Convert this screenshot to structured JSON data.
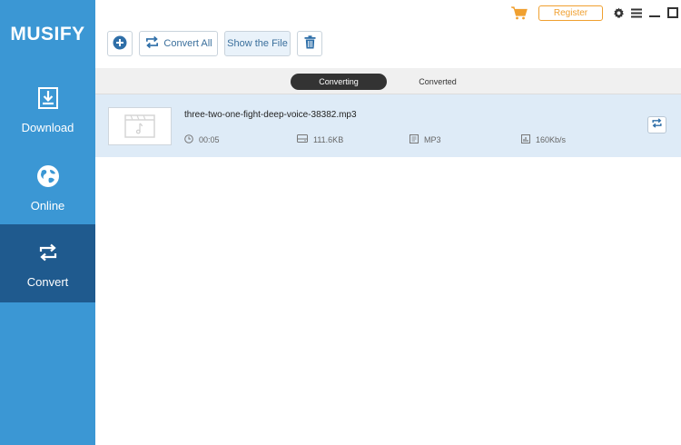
{
  "app": {
    "title": "MUSIFY"
  },
  "sidebar": {
    "items": [
      {
        "label": "Download",
        "icon": "download-icon"
      },
      {
        "label": "Online",
        "icon": "globe-icon"
      },
      {
        "label": "Convert",
        "icon": "convert-icon",
        "active": true
      }
    ]
  },
  "toolbar": {
    "add_icon": "plus-circle-icon",
    "convert_all_label": "Convert All",
    "show_file_label": "Show the File",
    "delete_icon": "trash-icon"
  },
  "header": {
    "register_label": "Register",
    "cart_icon": "cart-icon"
  },
  "tabs": [
    {
      "label": "Converting",
      "active": true
    },
    {
      "label": "Converted",
      "active": false
    }
  ],
  "files": [
    {
      "name": "three-two-one-fight-deep-voice-38382.mp3",
      "duration": "00:05",
      "size": "111.6KB",
      "format": "MP3",
      "bitrate": "160Kb/s"
    }
  ],
  "colors": {
    "sidebar": "#3b97d4",
    "sidebar_active": "#1f5a8e",
    "accent": "#f0a030",
    "row_highlight": "#deebf7"
  }
}
